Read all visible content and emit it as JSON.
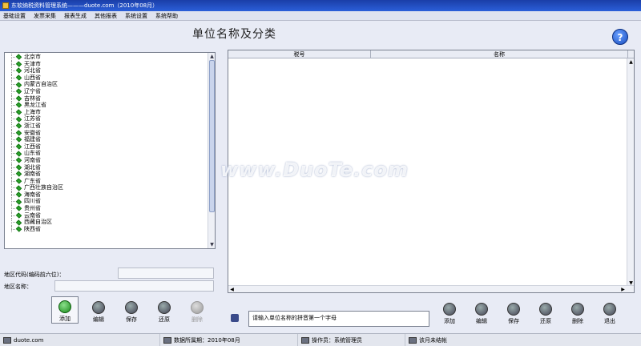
{
  "window": {
    "title": "东软纳税资料管理系统———duote.com（2010年08月）"
  },
  "menu": {
    "items": [
      "基础设置",
      "发票采集",
      "报表生成",
      "其他报表",
      "系统设置",
      "系统帮助"
    ]
  },
  "page": {
    "title": "单位名称及分类",
    "help_label": "?"
  },
  "region_tree": {
    "items": [
      "北京市",
      "天津市",
      "河北省",
      "山西省",
      "内蒙古自治区",
      "辽宁省",
      "吉林省",
      "黑龙江省",
      "上海市",
      "江苏省",
      "浙江省",
      "安徽省",
      "福建省",
      "江西省",
      "山东省",
      "河南省",
      "湖北省",
      "湖南省",
      "广东省",
      "广西壮族自治区",
      "海南省",
      "四川省",
      "贵州省",
      "云南省",
      "西藏自治区",
      "陕西省"
    ]
  },
  "region_form": {
    "code_label": "地区代码(编码前六位)：",
    "code_value": "",
    "name_label": "地区名称：",
    "name_value": ""
  },
  "left_buttons": {
    "add": "添加",
    "edit": "编辑",
    "save": "保存",
    "restore": "还原",
    "delete": "删除"
  },
  "grid": {
    "columns": [
      "税号",
      "名称"
    ]
  },
  "search_hint": "请输入单位名称的拼音第一个字母",
  "right_buttons": {
    "add": "添加",
    "edit": "编辑",
    "save": "保存",
    "restore": "还原",
    "delete": "删除",
    "exit": "退出"
  },
  "watermark": "www.DuoTe.com",
  "status": {
    "site": "duote.com",
    "period_label": "数据所属期：2010年08月",
    "operator_label": "操作员：系统管理员",
    "month_state": "该月未结帐"
  }
}
